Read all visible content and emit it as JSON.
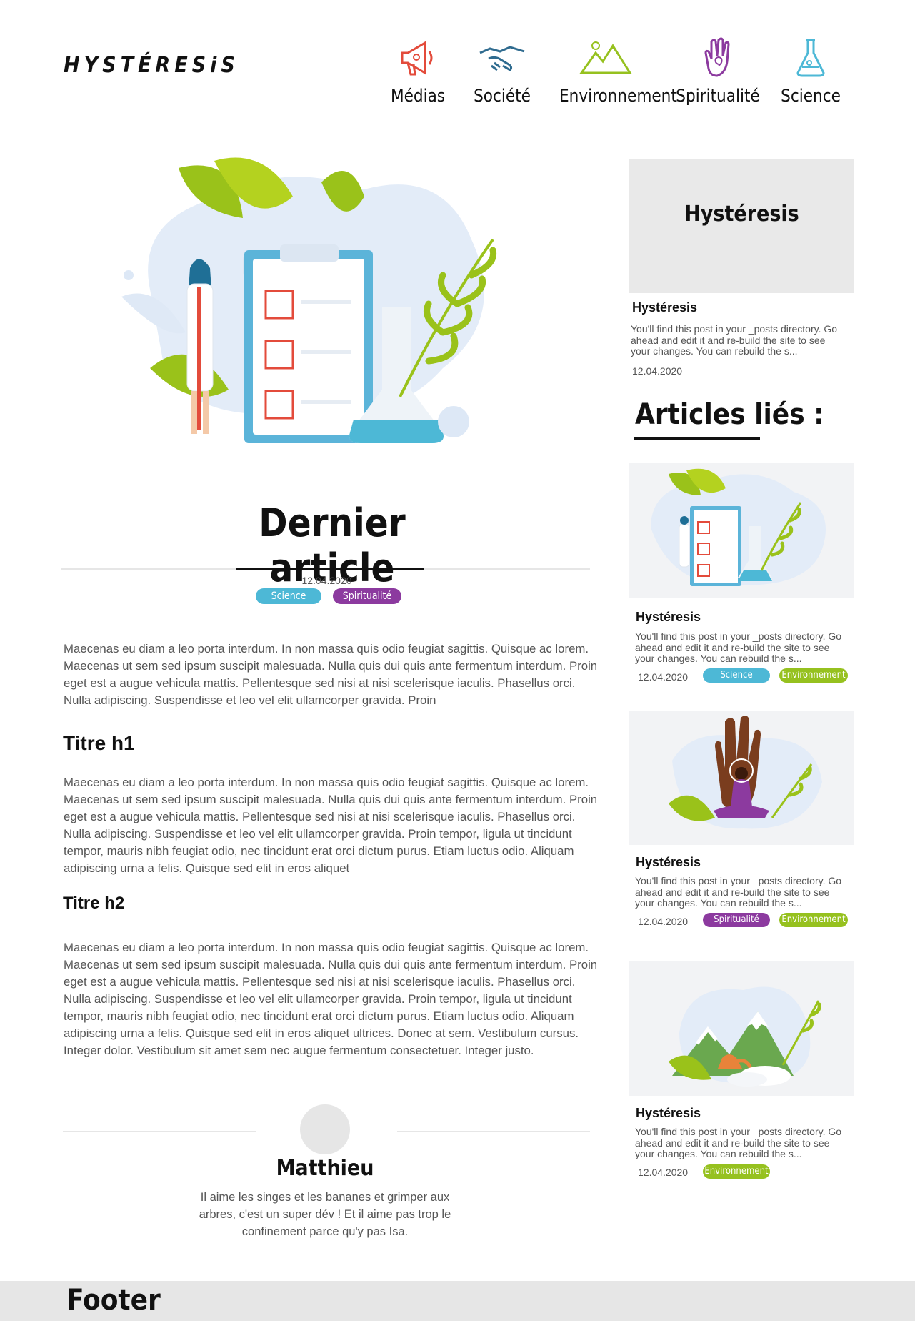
{
  "header": {
    "logo": "HYSTÉRESiS",
    "nav": [
      {
        "label": "Médias",
        "icon": "megaphone-icon",
        "color": "#e34b3b"
      },
      {
        "label": "Société",
        "icon": "handshake-icon",
        "color": "#2f6b8f"
      },
      {
        "label": "Environnement",
        "icon": "mountain-icon",
        "color": "#96c11f"
      },
      {
        "label": "Spiritualité",
        "icon": "hand-spiral-icon",
        "color": "#8c3a9f"
      },
      {
        "label": "Science",
        "icon": "flask-icon",
        "color": "#4db8d6"
      }
    ]
  },
  "article": {
    "title": "Dernier article",
    "date": "12.04.2020",
    "tags": [
      "Science",
      "Spiritualité"
    ],
    "intro": "Maecenas eu diam a leo porta interdum. In non massa quis odio feugiat sagittis. Quisque ac lorem. Maecenas ut sem sed ipsum suscipit malesuada. Nulla quis dui quis ante fermentum interdum. Proin eget est a augue vehicula mattis. Pellentesque sed nisi at nisi scelerisque iaculis. Phasellus orci. Nulla adipiscing. Suspendisse et leo vel elit ullamcorper gravida. Proin",
    "h1": "Titre h1",
    "p1": "Maecenas eu diam a leo porta interdum. In non massa quis odio feugiat sagittis. Quisque ac lorem. Maecenas ut sem sed ipsum suscipit malesuada. Nulla quis dui quis ante fermentum interdum. Proin eget est a augue vehicula mattis. Pellentesque sed nisi at nisi scelerisque iaculis. Phasellus orci. Nulla adipiscing. Suspendisse et leo vel elit ullamcorper gravida. Proin tempor, ligula ut tincidunt tempor, mauris nibh feugiat odio, nec tincidunt erat orci dictum purus. Etiam luctus odio. Aliquam adipiscing urna a felis. Quisque sed elit in eros aliquet",
    "h2": "Titre h2",
    "p2": "Maecenas eu diam a leo porta interdum. In non massa quis odio feugiat sagittis. Quisque ac lorem. Maecenas ut sem sed ipsum suscipit malesuada. Nulla quis dui quis ante fermentum interdum. Proin eget est a augue vehicula mattis. Pellentesque sed nisi at nisi scelerisque iaculis. Phasellus orci. Nulla adipiscing. Suspendisse et leo vel elit ullamcorper gravida. Proin tempor, ligula ut tincidunt tempor, mauris nibh feugiat odio, nec tincidunt erat orci dictum purus. Etiam luctus odio. Aliquam adipiscing urna a felis. Quisque sed elit in eros aliquet ultrices. Donec at sem. Vestibulum cursus. Integer dolor. Vestibulum sit amet sem nec augue fermentum consectetuer. Integer justo."
  },
  "author": {
    "name": "Matthieu",
    "bio": "Il aime les singes et les bananes et grimper aux arbres, c'est un super dév ! Et il aime pas trop le confinement parce qu'y pas Isa."
  },
  "sidebar": {
    "featured_image_text": "Hystéresis",
    "featured": {
      "title": "Hystéresis",
      "excerpt": "You'll find this post in your _posts directory. Go ahead and edit it and re-build the site to see your changes. You can rebuild the s...",
      "date": "12.04.2020"
    },
    "related_heading": "Articles liés :",
    "related": [
      {
        "title": "Hystéresis",
        "excerpt": "You'll find this post in your _posts directory. Go ahead and edit it and re-build the site to see your changes. You can rebuild the s...",
        "date": "12.04.2020",
        "tags": [
          "Science",
          "Environnement"
        ]
      },
      {
        "title": "Hystéresis",
        "excerpt": "You'll find this post in your _posts directory. Go ahead and edit it and re-build the site to see your changes. You can rebuild the s...",
        "date": "12.04.2020",
        "tags": [
          "Spiritualité",
          "Environnement"
        ]
      },
      {
        "title": "Hystéresis",
        "excerpt": "You'll find this post in your _posts directory. Go ahead and edit it and re-build the site to see your changes. You can rebuild the s...",
        "date": "12.04.2020",
        "tags": [
          "Environnement"
        ]
      }
    ]
  },
  "footer": {
    "text": "Footer"
  }
}
